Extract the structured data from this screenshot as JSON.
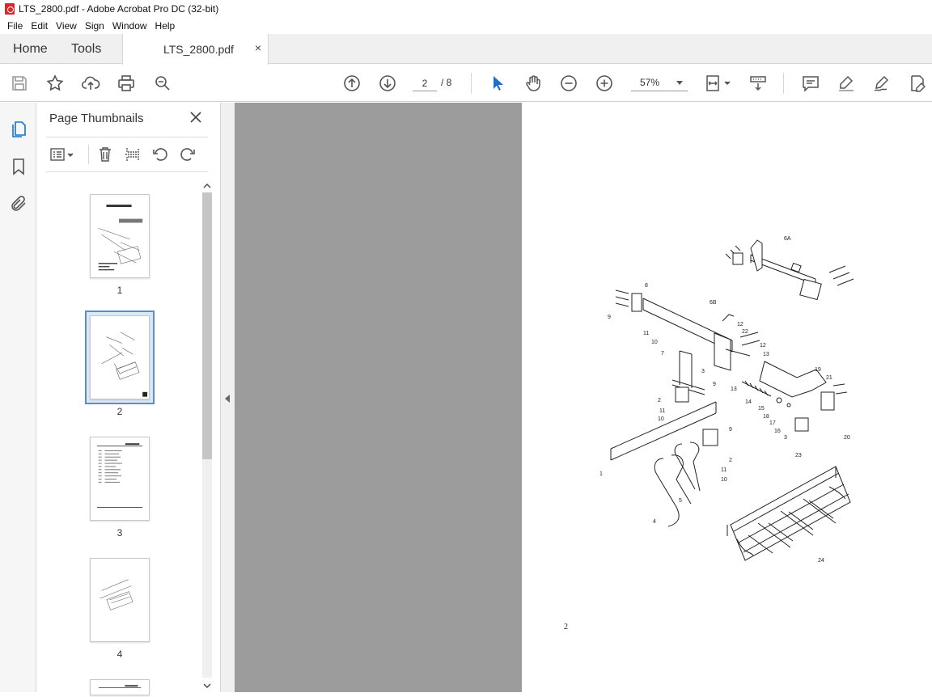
{
  "window": {
    "title": "LTS_2800.pdf - Adobe Acrobat Pro DC (32-bit)"
  },
  "menu": [
    "File",
    "Edit",
    "View",
    "Sign",
    "Window",
    "Help"
  ],
  "tabs": {
    "home": "Home",
    "tools": "Tools",
    "document": "LTS_2800.pdf",
    "close": "×"
  },
  "toolbar": {
    "current_page": "2",
    "total_pages": "/ 8",
    "zoom": "57%"
  },
  "thumbnails": {
    "title": "Page Thumbnails",
    "close": "×",
    "pages": [
      {
        "label": "1"
      },
      {
        "label": "2"
      },
      {
        "label": "3"
      },
      {
        "label": "4"
      }
    ],
    "selected_page": "2"
  },
  "document": {
    "page_footer": "2",
    "part_labels": [
      "6A",
      "6B",
      "8",
      "9",
      "11",
      "10",
      "12",
      "22",
      "12",
      "13",
      "7",
      "3",
      "9",
      "13",
      "19",
      "21",
      "14",
      "15",
      "18",
      "17",
      "16",
      "3",
      "20",
      "2",
      "11",
      "10",
      "9",
      "2",
      "11",
      "10",
      "1",
      "5",
      "4",
      "23",
      "24"
    ]
  }
}
